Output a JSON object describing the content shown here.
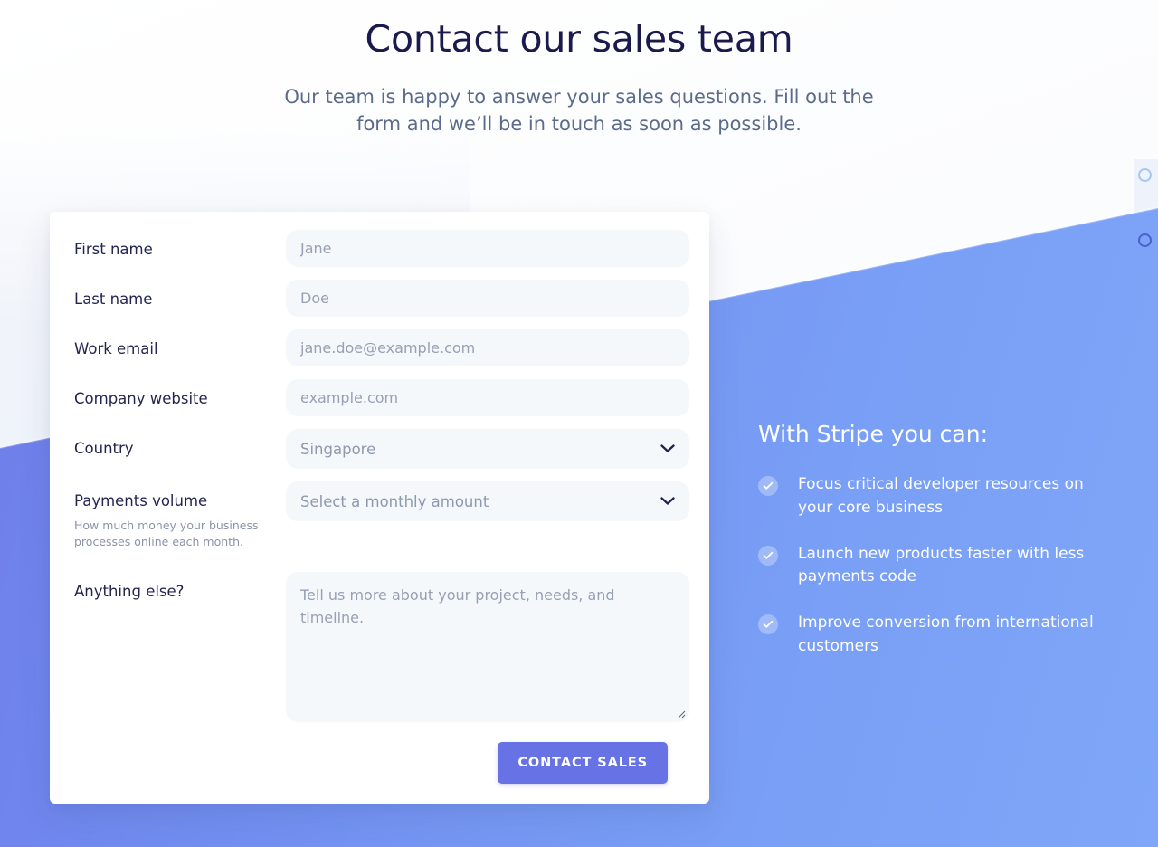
{
  "header": {
    "title": "Contact our sales team",
    "subtitle": "Our team is happy to answer your sales questions. Fill out the form and we’ll be in touch as soon as possible."
  },
  "form": {
    "fields": [
      {
        "label": "First name",
        "placeholder": "Jane",
        "type": "text"
      },
      {
        "label": "Last name",
        "placeholder": "Doe",
        "type": "text"
      },
      {
        "label": "Work email",
        "placeholder": "jane.doe@example.com",
        "type": "text"
      },
      {
        "label": "Company website",
        "placeholder": "example.com",
        "type": "text"
      },
      {
        "label": "Country",
        "value": "Singapore",
        "type": "select"
      },
      {
        "label": "Payments volume",
        "value": "Select a monthly amount",
        "type": "select",
        "help": "How much money your business processes online each month."
      },
      {
        "label": "Anything else?",
        "placeholder": "Tell us more about your project, needs, and timeline.",
        "type": "textarea"
      }
    ],
    "submit_label": "Contact sales"
  },
  "benefits": {
    "title": "With Stripe you can:",
    "items": [
      "Focus critical developer resources on your core business",
      "Launch new products faster with less payments code",
      "Improve conversion from international customers"
    ]
  },
  "colors": {
    "accent": "#6772e5",
    "heading": "#1b1a4d",
    "subtitle": "#5d6b8a",
    "field_bg": "#f5f8fb",
    "placeholder": "#97a0b4",
    "band_start": "#6f79e8",
    "band_end": "#7fa6f8"
  },
  "icons": {
    "chevron": "chevron-down-icon",
    "check": "check-icon",
    "resize": "resize-grip-icon"
  }
}
